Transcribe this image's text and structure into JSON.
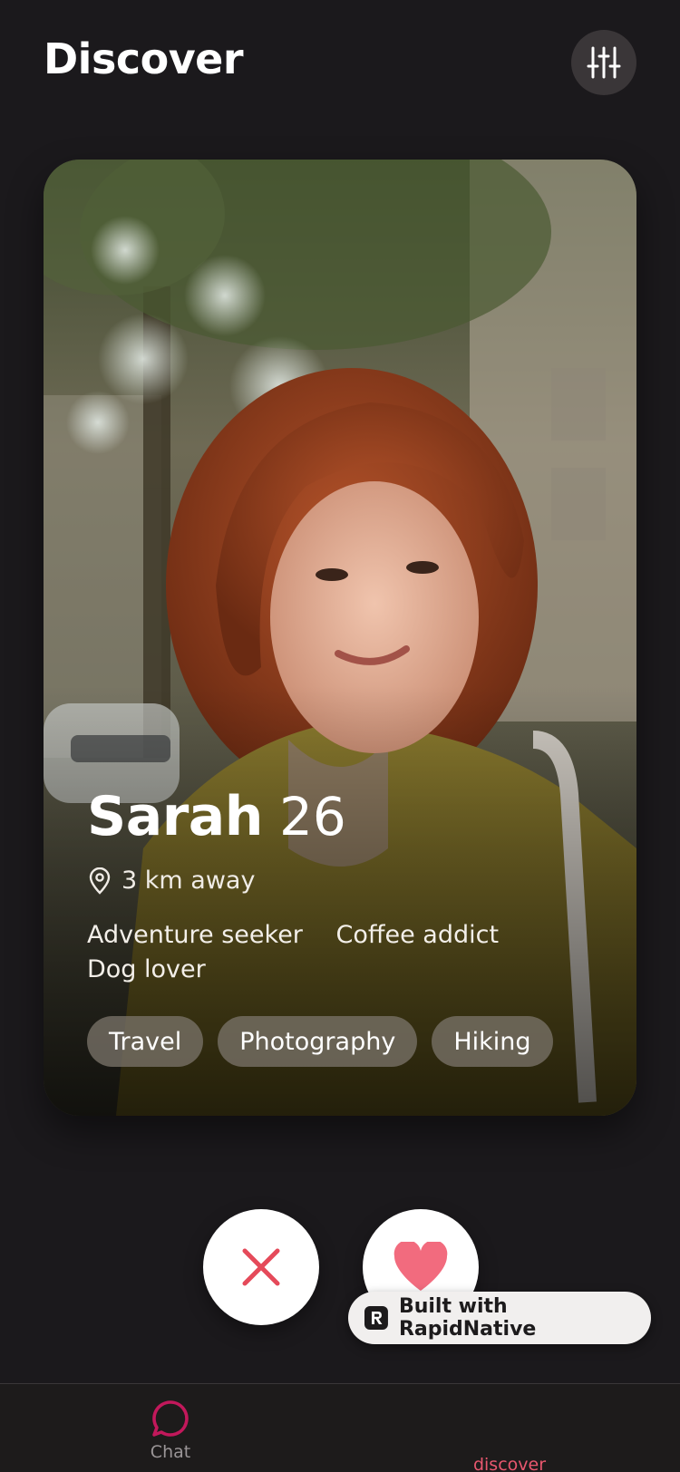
{
  "header": {
    "title": "Discover",
    "filter_icon": "sliders-icon"
  },
  "profile": {
    "name": "Sarah",
    "age": "26",
    "distance": "3 km away",
    "location_icon": "map-pin-icon",
    "bio": [
      "Adventure seeker",
      "Coffee addict",
      "Dog lover"
    ],
    "interests": [
      "Travel",
      "Photography",
      "Hiking"
    ]
  },
  "actions": {
    "pass_icon": "close-icon",
    "like_icon": "heart-icon"
  },
  "badge": {
    "label": "Built with RapidNative",
    "icon": "rapidnative-logo"
  },
  "tabbar": {
    "tabs": [
      {
        "label": "Chat",
        "icon": "chat-bubble-icon",
        "active": false
      },
      {
        "label": "discover",
        "icon": "",
        "active": true
      }
    ]
  },
  "colors": {
    "background": "#1b191c",
    "accent": "#e8576e",
    "pass_x": "#e54a5a",
    "chat_icon": "#c2185b"
  }
}
